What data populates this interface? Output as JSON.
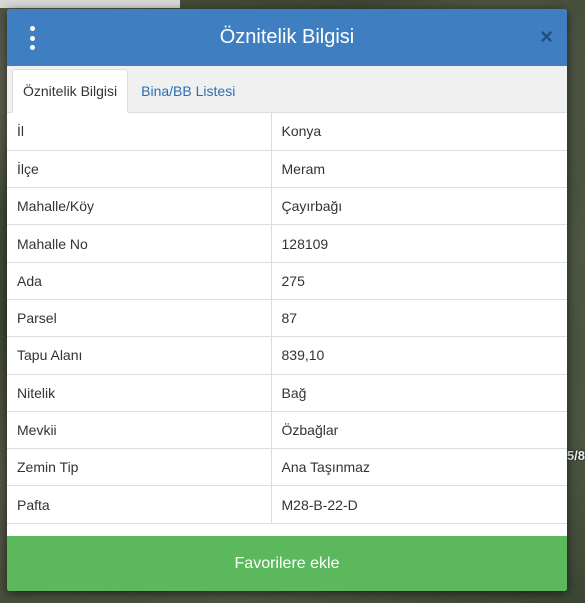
{
  "map": {
    "edge_label": "5/8"
  },
  "dialog": {
    "title": "Öznitelik Bilgisi",
    "close_symbol": "×",
    "icons": {
      "menu": "vertical-ellipsis-icon",
      "close": "close-icon"
    },
    "tabs": [
      {
        "label": "Öznitelik Bilgisi",
        "active": true
      },
      {
        "label": "Bina/BB Listesi",
        "active": false
      }
    ],
    "rows": [
      {
        "key": "İl",
        "value": "Konya"
      },
      {
        "key": "İlçe",
        "value": "Meram"
      },
      {
        "key": "Mahalle/Köy",
        "value": "Çayırbağı"
      },
      {
        "key": "Mahalle No",
        "value": "128109"
      },
      {
        "key": "Ada",
        "value": "275"
      },
      {
        "key": "Parsel",
        "value": "87"
      },
      {
        "key": "Tapu Alanı",
        "value": "839,10"
      },
      {
        "key": "Nitelik",
        "value": "Bağ"
      },
      {
        "key": "Mevkii",
        "value": "Özbağlar"
      },
      {
        "key": "Zemin Tip",
        "value": "Ana Taşınmaz"
      },
      {
        "key": "Pafta",
        "value": "M28-B-22-D"
      }
    ],
    "favorite_button": "Favorilere ekle",
    "colors": {
      "header": "#3f7fc1",
      "button": "#5cb85c",
      "tab_link": "#2a6fb5"
    }
  }
}
